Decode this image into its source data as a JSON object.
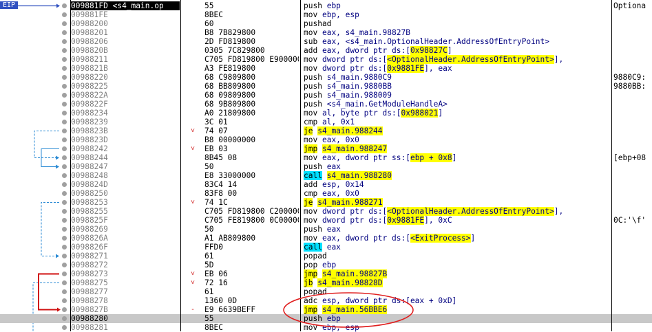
{
  "eip_label": "EIP",
  "selected_index": 35,
  "eip_index": 0,
  "rows": [
    {
      "addr": "009881FD <s4_main.op",
      "mark": "",
      "bytes": "55",
      "mn": "push",
      "ops": [
        {
          "t": "ebp"
        }
      ],
      "cmt": "Optiona"
    },
    {
      "addr": "009881FE",
      "mark": "",
      "bytes": "8BEC",
      "mn": "mov",
      "ops": [
        {
          "t": "ebp, esp"
        }
      ],
      "cmt": ""
    },
    {
      "addr": "00988200",
      "mark": "",
      "bytes": "60",
      "mn": "pushad",
      "ops": [],
      "cmt": ""
    },
    {
      "addr": "00988201",
      "mark": "",
      "bytes": "B8 7B829800",
      "mn": "mov",
      "ops": [
        {
          "t": "eax, s4_main.98827B"
        }
      ],
      "cmt": ""
    },
    {
      "addr": "00988206",
      "mark": "",
      "bytes": "2D FD819800",
      "mn": "sub",
      "ops": [
        {
          "t": "eax, <s4_main.OptionalHeader.AddressOfEntryPoint>"
        }
      ],
      "cmt": ""
    },
    {
      "addr": "0098820B",
      "mark": "",
      "bytes": "0305 7C829800",
      "mn": "add",
      "ops": [
        {
          "t": "eax, dword ptr ds:["
        },
        {
          "t": "0x98827C",
          "h": "y"
        },
        {
          "t": "]"
        }
      ],
      "cmt": ""
    },
    {
      "addr": "00988211",
      "mark": "",
      "bytes": "C705 FD819800 E9000000",
      "mn": "mov",
      "ops": [
        {
          "t": "dword ptr ds:["
        },
        {
          "t": "<OptionalHeader.AddressOfEntryPoint>",
          "h": "y"
        },
        {
          "t": "],"
        }
      ],
      "cmt": ""
    },
    {
      "addr": "0098821B",
      "mark": "",
      "bytes": "A3 FE819800",
      "mn": "mov",
      "ops": [
        {
          "t": "dword ptr ds:["
        },
        {
          "t": "0x9881FE",
          "h": "y"
        },
        {
          "t": "], eax"
        }
      ],
      "cmt": ""
    },
    {
      "addr": "00988220",
      "mark": "",
      "bytes": "68 C9809800",
      "mn": "push",
      "ops": [
        {
          "t": "s4_main.9880C9"
        }
      ],
      "cmt": "9880C9:"
    },
    {
      "addr": "00988225",
      "mark": "",
      "bytes": "68 BB809800",
      "mn": "push",
      "ops": [
        {
          "t": "s4_main.9880BB"
        }
      ],
      "cmt": "9880BB:"
    },
    {
      "addr": "0098822A",
      "mark": "",
      "bytes": "68 09809800",
      "mn": "push",
      "ops": [
        {
          "t": "s4_main.988009"
        }
      ],
      "cmt": ""
    },
    {
      "addr": "0098822F",
      "mark": "",
      "bytes": "68 9B809800",
      "mn": "push",
      "ops": [
        {
          "t": "<s4_main.GetModuleHandleA>"
        }
      ],
      "cmt": ""
    },
    {
      "addr": "00988234",
      "mark": "",
      "bytes": "A0 21809800",
      "mn": "mov",
      "ops": [
        {
          "t": "al, byte ptr ds:["
        },
        {
          "t": "0x988021",
          "h": "y"
        },
        {
          "t": "]"
        }
      ],
      "cmt": ""
    },
    {
      "addr": "00988239",
      "mark": "",
      "bytes": "3C 01",
      "mn": "cmp",
      "ops": [
        {
          "t": "al, 0x1"
        }
      ],
      "cmt": ""
    },
    {
      "addr": "0098823B",
      "mark": "˅",
      "bytes": "74 07",
      "mn": "je",
      "mnh": "y",
      "ops": [
        {
          "t": "s4_main.988244",
          "h": "y"
        }
      ],
      "cmt": ""
    },
    {
      "addr": "0098823D",
      "mark": "",
      "bytes": "B8 00000000",
      "mn": "mov",
      "ops": [
        {
          "t": "eax, 0x0"
        }
      ],
      "cmt": ""
    },
    {
      "addr": "00988242",
      "mark": "˅",
      "bytes": "EB 03",
      "mn": "jmp",
      "mnh": "y",
      "ops": [
        {
          "t": "s4_main.988247",
          "h": "y"
        }
      ],
      "cmt": ""
    },
    {
      "addr": "00988244",
      "mark": "",
      "bytes": "8B45 08",
      "mn": "mov",
      "ops": [
        {
          "t": "eax, dword ptr ss:["
        },
        {
          "t": "ebp + 0x8",
          "h": "y"
        },
        {
          "t": "]"
        }
      ],
      "cmt": "[ebp+08"
    },
    {
      "addr": "00988247",
      "mark": "",
      "bytes": "50",
      "mn": "push",
      "ops": [
        {
          "t": "eax"
        }
      ],
      "cmt": ""
    },
    {
      "addr": "00988248",
      "mark": "",
      "bytes": "E8 33000000",
      "mn": "call",
      "mnh": "c",
      "ops": [
        {
          "t": "s4_main.988280",
          "h": "y"
        }
      ],
      "cmt": ""
    },
    {
      "addr": "0098824D",
      "mark": "",
      "bytes": "83C4 14",
      "mn": "add",
      "ops": [
        {
          "t": "esp, 0x14"
        }
      ],
      "cmt": ""
    },
    {
      "addr": "00988250",
      "mark": "",
      "bytes": "83F8 00",
      "mn": "cmp",
      "ops": [
        {
          "t": "eax, 0x0"
        }
      ],
      "cmt": ""
    },
    {
      "addr": "00988253",
      "mark": "˅",
      "bytes": "74 1C",
      "mn": "je",
      "mnh": "y",
      "ops": [
        {
          "t": "s4_main.988271",
          "h": "y"
        }
      ],
      "cmt": ""
    },
    {
      "addr": "00988255",
      "mark": "",
      "bytes": "C705 FD819800 C2000000",
      "mn": "mov",
      "ops": [
        {
          "t": "dword ptr ds:["
        },
        {
          "t": "<OptionalHeader.AddressOfEntryPoint>",
          "h": "y"
        },
        {
          "t": "],"
        }
      ],
      "cmt": ""
    },
    {
      "addr": "0098825F",
      "mark": "",
      "bytes": "C705 FE819800 0C000000",
      "mn": "mov",
      "ops": [
        {
          "t": "dword ptr ds:["
        },
        {
          "t": "0x9881FE",
          "h": "y"
        },
        {
          "t": "], 0xC"
        }
      ],
      "cmt": "0C:'\\f'"
    },
    {
      "addr": "00988269",
      "mark": "",
      "bytes": "50",
      "mn": "push",
      "ops": [
        {
          "t": "eax"
        }
      ],
      "cmt": ""
    },
    {
      "addr": "0098826A",
      "mark": "",
      "bytes": "A1 AB809800",
      "mn": "mov",
      "ops": [
        {
          "t": "eax, dword ptr ds:["
        },
        {
          "t": "<ExitProcess>",
          "h": "y"
        },
        {
          "t": "]"
        }
      ],
      "cmt": ""
    },
    {
      "addr": "0098826F",
      "mark": "",
      "bytes": "FFD0",
      "mn": "call",
      "mnh": "c",
      "ops": [
        {
          "t": "eax"
        }
      ],
      "cmt": ""
    },
    {
      "addr": "00988271",
      "mark": "",
      "bytes": "61",
      "mn": "popad",
      "ops": [],
      "cmt": ""
    },
    {
      "addr": "00988272",
      "mark": "",
      "bytes": "5D",
      "mn": "pop",
      "ops": [
        {
          "t": "ebp"
        }
      ],
      "cmt": ""
    },
    {
      "addr": "00988273",
      "mark": "˅",
      "bytes": "EB 06",
      "mn": "jmp",
      "mnh": "y",
      "ops": [
        {
          "t": "s4_main.98827B",
          "h": "y"
        }
      ],
      "cmt": ""
    },
    {
      "addr": "00988275",
      "mark": "˅",
      "bytes": "72 16",
      "mn": "jb",
      "mnh": "y",
      "ops": [
        {
          "t": "s4_main.98828D",
          "h": "y"
        }
      ],
      "cmt": ""
    },
    {
      "addr": "00988277",
      "mark": "",
      "bytes": "61",
      "mn": "popad",
      "ops": [],
      "cmt": ""
    },
    {
      "addr": "00988278",
      "mark": "",
      "bytes": "1360 0D",
      "mn": "adc",
      "ops": [
        {
          "t": "esp, dword ptr ds:[eax + 0xD]"
        }
      ],
      "cmt": ""
    },
    {
      "addr": "0098827B",
      "mark": "-",
      "bytes": "E9 6639BEFF",
      "mn": "jmp",
      "mnh": "y",
      "ops": [
        {
          "t": "s4_main.56BBE6",
          "h": "y"
        }
      ],
      "cmt": ""
    },
    {
      "addr": "00988280",
      "mark": "",
      "bytes": "55",
      "mn": "push",
      "ops": [
        {
          "t": "ebp"
        }
      ],
      "cmt": ""
    },
    {
      "addr": "00988281",
      "mark": "",
      "bytes": "8BEC",
      "mn": "mov",
      "ops": [
        {
          "t": "ebp, esp"
        }
      ],
      "cmt": ""
    }
  ]
}
